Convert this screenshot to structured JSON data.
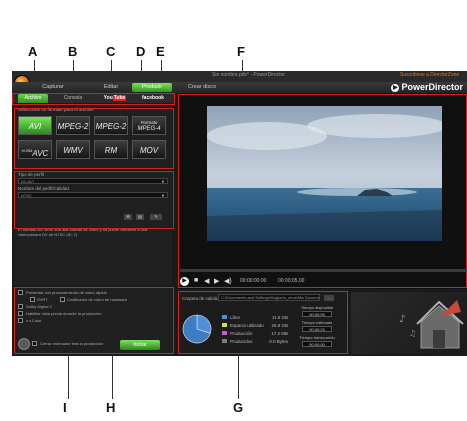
{
  "callouts": {
    "top": [
      "A",
      "B",
      "C",
      "D",
      "E",
      "F"
    ],
    "bottom": [
      "I",
      "H",
      "G"
    ]
  },
  "window": {
    "title": "Sin nombre.pdx* - PowerDirector",
    "help_link": "Suscribirse a DirectorZone",
    "brand": "PowerDirector"
  },
  "modes": [
    {
      "label": "Capturar"
    },
    {
      "label": "Editar"
    },
    {
      "label": "Producir",
      "active": true
    },
    {
      "label": "Crear disco"
    }
  ],
  "tabs": [
    {
      "label": "Archivo",
      "active": true
    },
    {
      "label": "Consola"
    },
    {
      "label": "YouTube",
      "display_prefix": "You",
      "display_suffix": "Tube"
    },
    {
      "label": "facebook"
    }
  ],
  "formats": {
    "section_label": "Seleccione un formato para el archivo",
    "items": [
      {
        "label": "AVI",
        "active": true
      },
      {
        "label": "MPEG-2"
      },
      {
        "label": "MPEG-2"
      },
      {
        "label": "Formato MPEG-4",
        "line1": "Formato",
        "line2": "MPEG-4"
      },
      {
        "label": "AVC",
        "sup": "H.264"
      },
      {
        "label": "WMV"
      },
      {
        "label": "RM"
      },
      {
        "label": "MOV"
      }
    ]
  },
  "profile": {
    "type_label": "Tipo de perfil",
    "type_value": "DV-AVI",
    "quality_label": "Nombre del perfil/Calidad",
    "quality_value": "NTSC",
    "description": "El formato AVI tiene una alta calidad de vídeo y se puede transferir a una videocámara DV de NTSC (ID: 1)"
  },
  "options": {
    "items": [
      {
        "label": "Presentar con procesamiento de vídeo rápido"
      },
      {
        "label": "SVRT"
      },
      {
        "label": "Codificador de vídeo de hardware"
      },
      {
        "label": "Dolby Digital 2"
      },
      {
        "label": "Habilitar vista previa durante la producción"
      },
      {
        "label": "x.v.Color"
      }
    ],
    "shutdown_label": "Cerrar ordenador tras la producción",
    "start_label": "Iniciar"
  },
  "preview": {
    "timecode_current": "00:00:00.00",
    "timecode_total": "00:00:05.00"
  },
  "output": {
    "folder_label": "Carpeta de salida:",
    "folder_path": "C:\\Documents and Settings\\Sagrario_chus\\Mis Documentos\\Producir.avi",
    "browse_label": "...",
    "legend": [
      {
        "label": "Libre",
        "value": "11.6 GB",
        "color": "#4f8fd8"
      },
      {
        "label": "Espacio utilizado",
        "value": "26.9 GB",
        "color": "#cfe04a"
      },
      {
        "label": "Producción",
        "value": "17.2 MB",
        "color": "#c65ad0"
      },
      {
        "label": "Producidos",
        "value": "0.0 Bytes",
        "color": "#7d7d7d"
      }
    ],
    "pie": [
      {
        "label": "Libre",
        "fraction": 0.3,
        "color": "#4f8fd8"
      },
      {
        "label": "Espacio utilizado",
        "fraction": 0.7,
        "color": "#3f7cc4"
      }
    ],
    "stats": [
      {
        "label": "Tiempo disponible",
        "value": "00:00:09"
      },
      {
        "label": "Tiempo estimado",
        "value": "00:00:23"
      },
      {
        "label": "Tiempo transcurrido",
        "value": "00:00:00"
      }
    ]
  }
}
